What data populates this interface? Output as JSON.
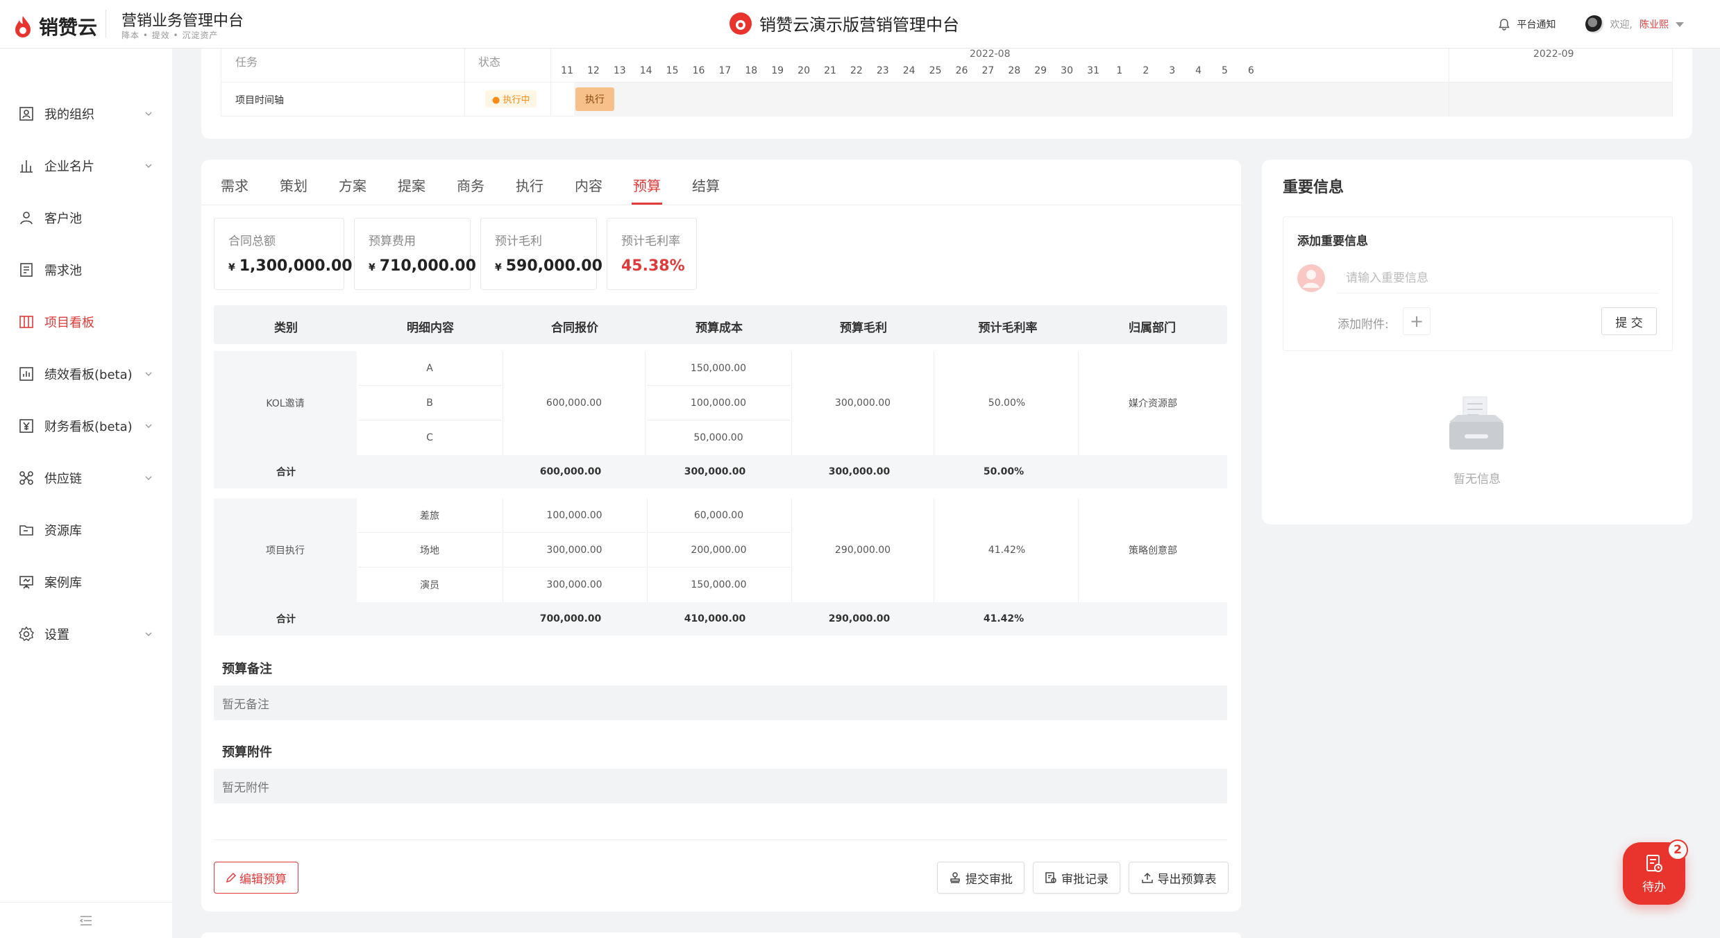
{
  "header": {
    "logo_text": "销赞云",
    "system_title": "营销业务管理中台",
    "system_subtitle": "降本 • 提效 • 沉淀资产",
    "center_title": "销赞云演示版营销管理中台",
    "notice_label": "平台通知",
    "welcome": "欢迎,",
    "username": "陈业熙"
  },
  "sidebar": {
    "items": [
      {
        "label": "我的组织",
        "icon": "org-icon",
        "chevron": true
      },
      {
        "label": "企业名片",
        "icon": "card-icon",
        "chevron": true
      },
      {
        "label": "客户池",
        "icon": "user-icon",
        "chevron": false
      },
      {
        "label": "需求池",
        "icon": "doc-icon",
        "chevron": false
      },
      {
        "label": "项目看板",
        "icon": "kanban-icon",
        "chevron": false,
        "active": true
      },
      {
        "label": "绩效看板(beta)",
        "icon": "chart-icon",
        "chevron": true
      },
      {
        "label": "财务看板(beta)",
        "icon": "yen-icon",
        "chevron": true
      },
      {
        "label": "供应链",
        "icon": "supply-icon",
        "chevron": true
      },
      {
        "label": "资源库",
        "icon": "folder-icon",
        "chevron": false
      },
      {
        "label": "案例库",
        "icon": "case-icon",
        "chevron": false
      },
      {
        "label": "设置",
        "icon": "gear-icon",
        "chevron": true
      }
    ]
  },
  "gantt": {
    "col_task": "任务",
    "col_status": "状态",
    "month_aug": "2022-08",
    "month_sep": "2022-09",
    "days": [
      "11",
      "12",
      "13",
      "14",
      "15",
      "16",
      "17",
      "18",
      "19",
      "20",
      "21",
      "22",
      "23",
      "24",
      "25",
      "26",
      "27",
      "28",
      "29",
      "30",
      "31",
      "1",
      "2",
      "3",
      "4",
      "5",
      "6"
    ],
    "task": "项目时间轴",
    "status": "● 执行中",
    "bar_label": "执行"
  },
  "tabs": [
    "需求",
    "策划",
    "方案",
    "提案",
    "商务",
    "执行",
    "内容",
    "预算",
    "结算"
  ],
  "active_tab": "预算",
  "stats": [
    {
      "label": "合同总额",
      "currency": "¥",
      "value": "1,300,000.00"
    },
    {
      "label": "预算费用",
      "currency": "¥",
      "value": "710,000.00"
    },
    {
      "label": "预计毛利",
      "currency": "¥",
      "value": "590,000.00"
    },
    {
      "label": "预计毛利率",
      "value": "45.38%"
    }
  ],
  "budget_table": {
    "headers": [
      "类别",
      "明细内容",
      "合同报价",
      "预算成本",
      "预算毛利",
      "预计毛利率",
      "归属部门"
    ],
    "groups": [
      {
        "category": "KOL邀请",
        "items": [
          "A",
          "B",
          "C"
        ],
        "contract": "600,000.00",
        "costs": [
          "150,000.00",
          "100,000.00",
          "50,000.00"
        ],
        "profit": "300,000.00",
        "rate": "50.00%",
        "dept": "媒介资源部",
        "sum": {
          "label": "合计",
          "contract": "600,000.00",
          "cost": "300,000.00",
          "profit": "300,000.00",
          "rate": "50.00%"
        }
      },
      {
        "category": "项目执行",
        "items": [
          "差旅",
          "场地",
          "演员"
        ],
        "contracts": [
          "100,000.00",
          "300,000.00",
          "300,000.00"
        ],
        "costs": [
          "60,000.00",
          "200,000.00",
          "150,000.00"
        ],
        "profit": "290,000.00",
        "rate": "41.42%",
        "dept": "策略创意部",
        "sum": {
          "label": "合计",
          "contract": "700,000.00",
          "cost": "410,000.00",
          "profit": "290,000.00",
          "rate": "41.42%"
        }
      }
    ]
  },
  "notes": {
    "title": "预算备注",
    "empty": "暂无备注"
  },
  "attachments": {
    "title": "预算附件",
    "empty": "暂无附件"
  },
  "actions": {
    "edit": "编辑预算",
    "submit": "提交审批",
    "records": "审批记录",
    "export": "导出预算表"
  },
  "important": {
    "title": "重要信息",
    "add_title": "添加重要信息",
    "placeholder": "请输入重要信息",
    "attach_label": "添加附件:",
    "submit": "提 交",
    "empty": "暂无信息"
  },
  "todo": {
    "label": "待办",
    "count": "2"
  },
  "colors": {
    "accent": "#e03a3a",
    "status_orange": "#fa8c16",
    "bar": "#f7c08a"
  }
}
